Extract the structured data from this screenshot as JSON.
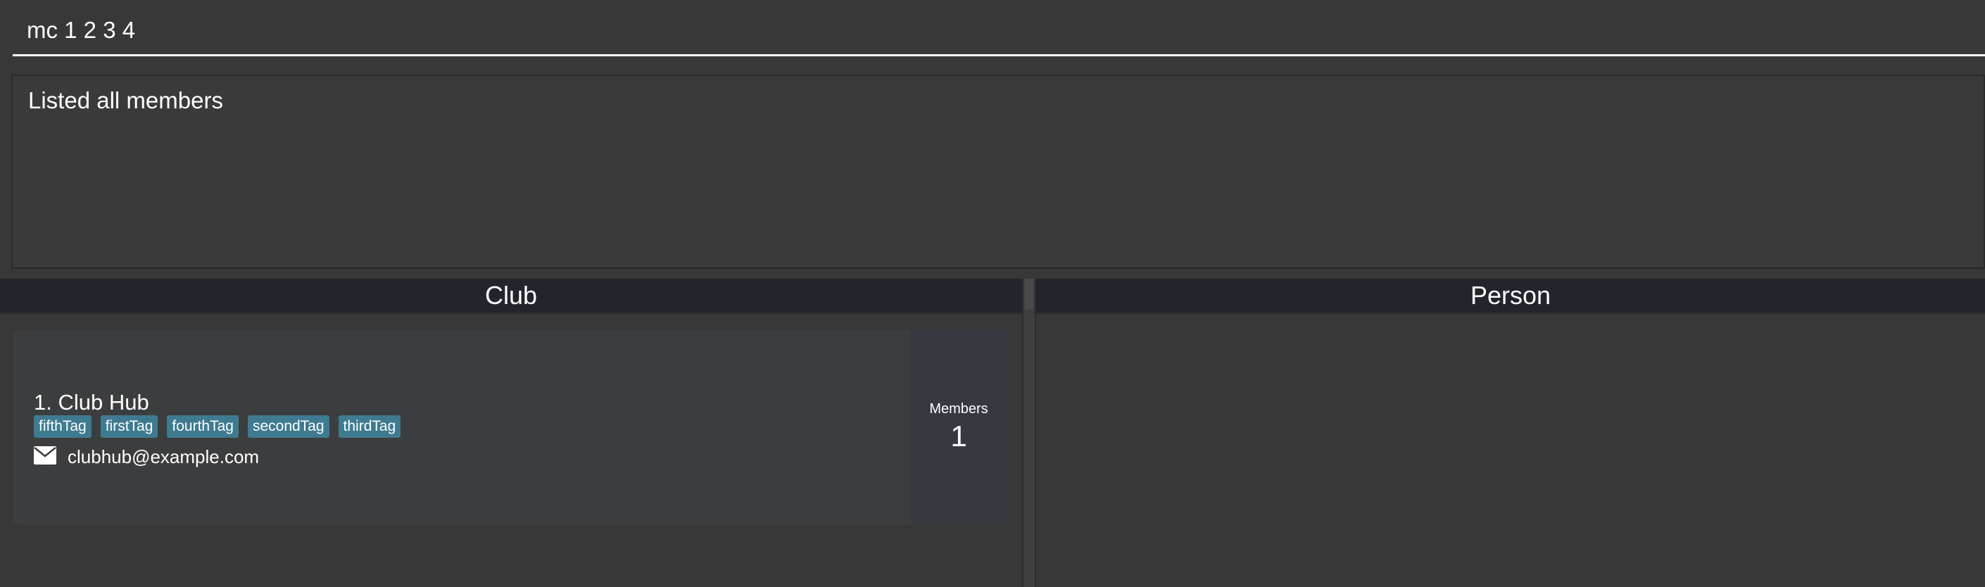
{
  "command": {
    "value": "mc 1 2 3 4"
  },
  "result": {
    "text": "Listed all members"
  },
  "panels": {
    "club_title": "Club",
    "person_title": "Person"
  },
  "clubs": [
    {
      "index_name": "1. Club Hub",
      "tags": [
        "fifthTag",
        "firstTag",
        "fourthTag",
        "secondTag",
        "thirdTag"
      ],
      "email": "clubhub@example.com",
      "members_label": "Members",
      "members_count": "1"
    }
  ],
  "colors": {
    "background": "#383838",
    "header": "#22252c",
    "tag": "#3e7b91",
    "card": "#3c3d3f"
  },
  "icons": {
    "email": "envelope-icon"
  }
}
